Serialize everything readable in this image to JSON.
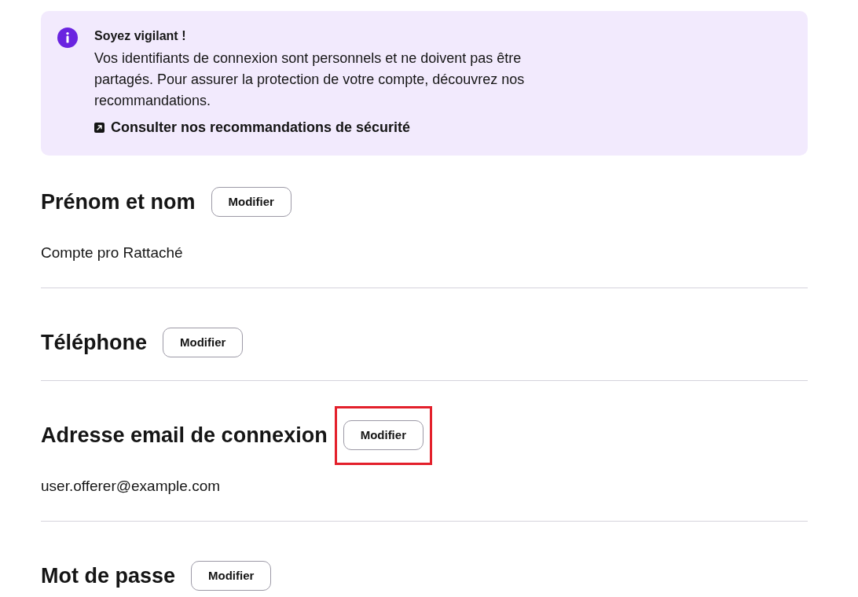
{
  "callout": {
    "title": "Soyez vigilant !",
    "text": "Vos identifiants de connexion sont personnels et ne doivent pas être partagés. Pour assurer la protection de votre compte, découvrez nos recommandations.",
    "link": {
      "label": "Consulter nos recommandations de sécurité"
    }
  },
  "sections": [
    {
      "title": "Prénom et nom",
      "button": "Modifier",
      "value": "Compte pro Rattaché",
      "highlighted": false
    },
    {
      "title": "Téléphone",
      "button": "Modifier",
      "highlighted": false
    },
    {
      "title": "Adresse email de connexion",
      "button": "Modifier",
      "value": "user.offerer@example.com",
      "highlighted": true
    },
    {
      "title": "Mot de passe",
      "button": "Modifier",
      "highlighted": false
    }
  ]
}
